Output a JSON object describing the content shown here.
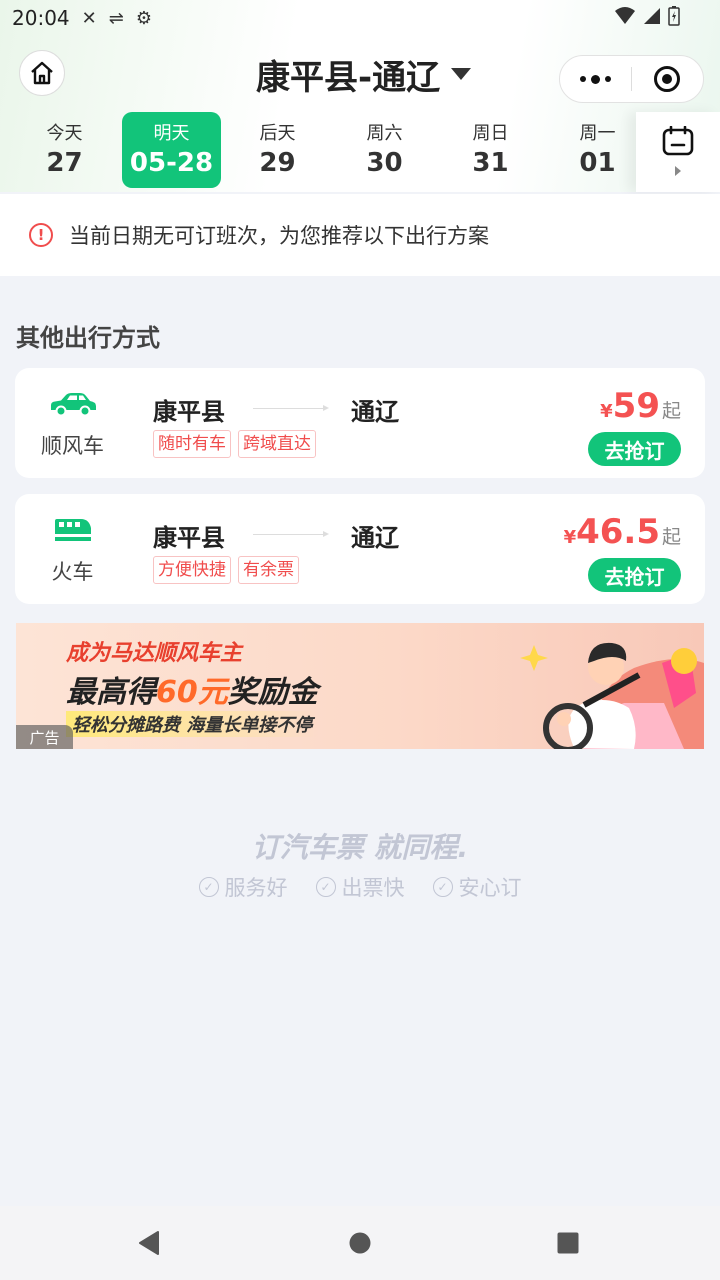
{
  "status_bar": {
    "time": "20:04"
  },
  "header": {
    "title": "康平县-通辽"
  },
  "dates": [
    {
      "weekday": "今天",
      "date": "27",
      "active": false
    },
    {
      "weekday": "明天",
      "date": "05-28",
      "active": true
    },
    {
      "weekday": "后天",
      "date": "29",
      "active": false
    },
    {
      "weekday": "周六",
      "date": "30",
      "active": false
    },
    {
      "weekday": "周日",
      "date": "31",
      "active": false
    },
    {
      "weekday": "周一",
      "date": "01",
      "active": false
    }
  ],
  "notice": {
    "text": "当前日期无可订班次，为您推荐以下出行方案"
  },
  "section": {
    "title": "其他出行方式"
  },
  "options": [
    {
      "mode": "顺风车",
      "icon": "car-icon",
      "from": "康平县",
      "to": "通辽",
      "tags": [
        "随时有车",
        "跨域直达"
      ],
      "currency": "¥",
      "price": "59",
      "suffix": "起",
      "button": "去抢订"
    },
    {
      "mode": "火车",
      "icon": "train-icon",
      "from": "康平县",
      "to": "通辽",
      "tags": [
        "方便快捷",
        "有余票"
      ],
      "currency": "¥",
      "price": "46.5",
      "suffix": "起",
      "button": "去抢订"
    }
  ],
  "ad": {
    "line1": "成为马达顺风车主",
    "line2_prefix": "最高得",
    "line2_highlight": "60元",
    "line2_suffix": "奖励金",
    "line3": "轻松分摊路费 海量长单接不停",
    "badge": "广告"
  },
  "footer": {
    "slogan": "订汽车票 就同程.",
    "features": [
      "服务好",
      "出票快",
      "安心订"
    ]
  },
  "colors": {
    "accent": "#12c47a",
    "price": "#f45252",
    "warning": "#f04d4d"
  }
}
